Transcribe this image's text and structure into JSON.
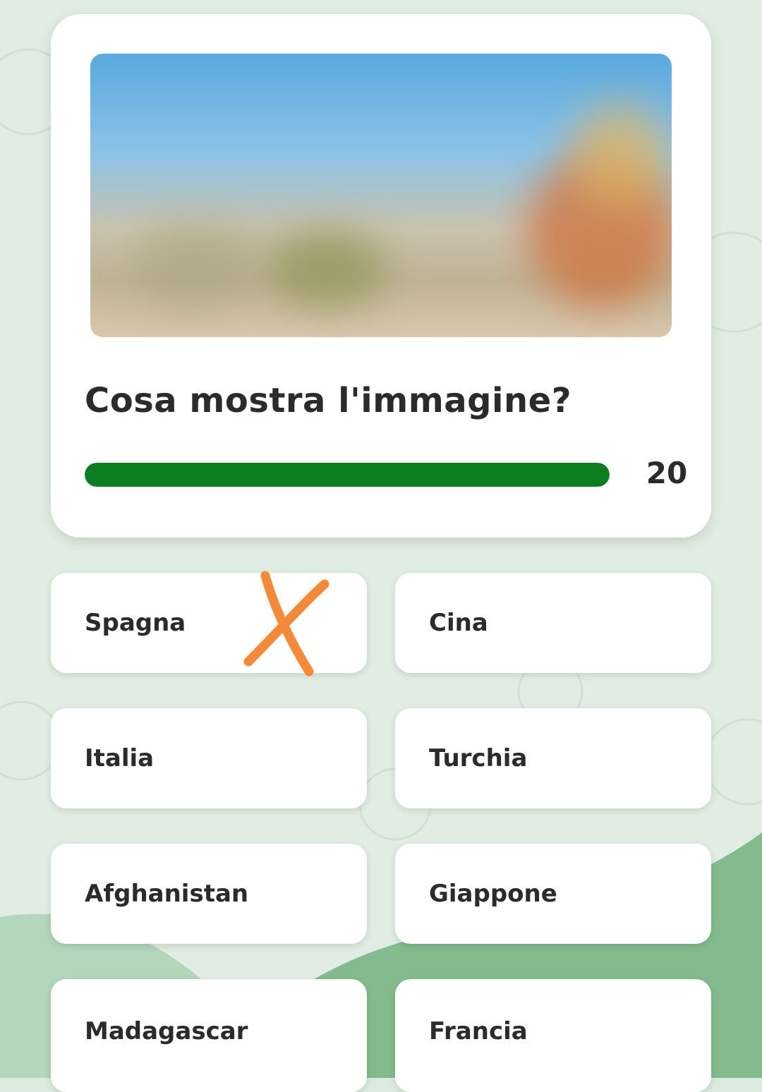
{
  "question": {
    "text": "Cosa mostra l'immagine?",
    "timer": "20",
    "progress_fraction": 1.0
  },
  "options": [
    {
      "label": "Spagna"
    },
    {
      "label": "Cina"
    },
    {
      "label": "Italia"
    },
    {
      "label": "Turchia"
    },
    {
      "label": "Afghanistan"
    },
    {
      "label": "Giappone"
    },
    {
      "label": "Madagascar"
    },
    {
      "label": "Francia"
    }
  ],
  "colors": {
    "progress": "#0d7d22",
    "background": "#dcebdf",
    "accent_green": "#83bb8e",
    "annotation": "#f5893a"
  },
  "annotation": {
    "icon": "cross-mark-icon"
  }
}
